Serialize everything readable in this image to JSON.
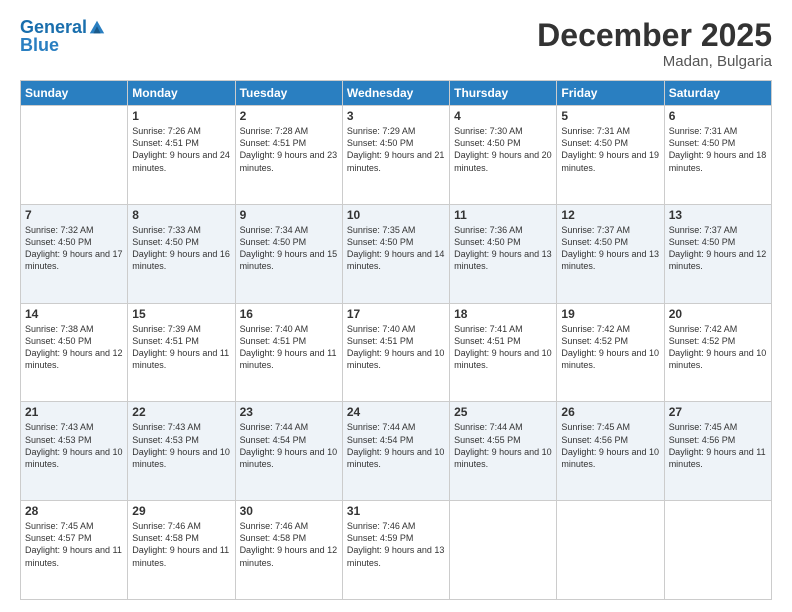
{
  "header": {
    "logo_line1": "General",
    "logo_line2": "Blue",
    "month": "December 2025",
    "location": "Madan, Bulgaria"
  },
  "days_of_week": [
    "Sunday",
    "Monday",
    "Tuesday",
    "Wednesday",
    "Thursday",
    "Friday",
    "Saturday"
  ],
  "weeks": [
    [
      {
        "day": "",
        "sunrise": "",
        "sunset": "",
        "daylight": ""
      },
      {
        "day": "1",
        "sunrise": "Sunrise: 7:26 AM",
        "sunset": "Sunset: 4:51 PM",
        "daylight": "Daylight: 9 hours and 24 minutes."
      },
      {
        "day": "2",
        "sunrise": "Sunrise: 7:28 AM",
        "sunset": "Sunset: 4:51 PM",
        "daylight": "Daylight: 9 hours and 23 minutes."
      },
      {
        "day": "3",
        "sunrise": "Sunrise: 7:29 AM",
        "sunset": "Sunset: 4:50 PM",
        "daylight": "Daylight: 9 hours and 21 minutes."
      },
      {
        "day": "4",
        "sunrise": "Sunrise: 7:30 AM",
        "sunset": "Sunset: 4:50 PM",
        "daylight": "Daylight: 9 hours and 20 minutes."
      },
      {
        "day": "5",
        "sunrise": "Sunrise: 7:31 AM",
        "sunset": "Sunset: 4:50 PM",
        "daylight": "Daylight: 9 hours and 19 minutes."
      },
      {
        "day": "6",
        "sunrise": "Sunrise: 7:31 AM",
        "sunset": "Sunset: 4:50 PM",
        "daylight": "Daylight: 9 hours and 18 minutes."
      }
    ],
    [
      {
        "day": "7",
        "sunrise": "Sunrise: 7:32 AM",
        "sunset": "Sunset: 4:50 PM",
        "daylight": "Daylight: 9 hours and 17 minutes."
      },
      {
        "day": "8",
        "sunrise": "Sunrise: 7:33 AM",
        "sunset": "Sunset: 4:50 PM",
        "daylight": "Daylight: 9 hours and 16 minutes."
      },
      {
        "day": "9",
        "sunrise": "Sunrise: 7:34 AM",
        "sunset": "Sunset: 4:50 PM",
        "daylight": "Daylight: 9 hours and 15 minutes."
      },
      {
        "day": "10",
        "sunrise": "Sunrise: 7:35 AM",
        "sunset": "Sunset: 4:50 PM",
        "daylight": "Daylight: 9 hours and 14 minutes."
      },
      {
        "day": "11",
        "sunrise": "Sunrise: 7:36 AM",
        "sunset": "Sunset: 4:50 PM",
        "daylight": "Daylight: 9 hours and 13 minutes."
      },
      {
        "day": "12",
        "sunrise": "Sunrise: 7:37 AM",
        "sunset": "Sunset: 4:50 PM",
        "daylight": "Daylight: 9 hours and 13 minutes."
      },
      {
        "day": "13",
        "sunrise": "Sunrise: 7:37 AM",
        "sunset": "Sunset: 4:50 PM",
        "daylight": "Daylight: 9 hours and 12 minutes."
      }
    ],
    [
      {
        "day": "14",
        "sunrise": "Sunrise: 7:38 AM",
        "sunset": "Sunset: 4:50 PM",
        "daylight": "Daylight: 9 hours and 12 minutes."
      },
      {
        "day": "15",
        "sunrise": "Sunrise: 7:39 AM",
        "sunset": "Sunset: 4:51 PM",
        "daylight": "Daylight: 9 hours and 11 minutes."
      },
      {
        "day": "16",
        "sunrise": "Sunrise: 7:40 AM",
        "sunset": "Sunset: 4:51 PM",
        "daylight": "Daylight: 9 hours and 11 minutes."
      },
      {
        "day": "17",
        "sunrise": "Sunrise: 7:40 AM",
        "sunset": "Sunset: 4:51 PM",
        "daylight": "Daylight: 9 hours and 10 minutes."
      },
      {
        "day": "18",
        "sunrise": "Sunrise: 7:41 AM",
        "sunset": "Sunset: 4:51 PM",
        "daylight": "Daylight: 9 hours and 10 minutes."
      },
      {
        "day": "19",
        "sunrise": "Sunrise: 7:42 AM",
        "sunset": "Sunset: 4:52 PM",
        "daylight": "Daylight: 9 hours and 10 minutes."
      },
      {
        "day": "20",
        "sunrise": "Sunrise: 7:42 AM",
        "sunset": "Sunset: 4:52 PM",
        "daylight": "Daylight: 9 hours and 10 minutes."
      }
    ],
    [
      {
        "day": "21",
        "sunrise": "Sunrise: 7:43 AM",
        "sunset": "Sunset: 4:53 PM",
        "daylight": "Daylight: 9 hours and 10 minutes."
      },
      {
        "day": "22",
        "sunrise": "Sunrise: 7:43 AM",
        "sunset": "Sunset: 4:53 PM",
        "daylight": "Daylight: 9 hours and 10 minutes."
      },
      {
        "day": "23",
        "sunrise": "Sunrise: 7:44 AM",
        "sunset": "Sunset: 4:54 PM",
        "daylight": "Daylight: 9 hours and 10 minutes."
      },
      {
        "day": "24",
        "sunrise": "Sunrise: 7:44 AM",
        "sunset": "Sunset: 4:54 PM",
        "daylight": "Daylight: 9 hours and 10 minutes."
      },
      {
        "day": "25",
        "sunrise": "Sunrise: 7:44 AM",
        "sunset": "Sunset: 4:55 PM",
        "daylight": "Daylight: 9 hours and 10 minutes."
      },
      {
        "day": "26",
        "sunrise": "Sunrise: 7:45 AM",
        "sunset": "Sunset: 4:56 PM",
        "daylight": "Daylight: 9 hours and 10 minutes."
      },
      {
        "day": "27",
        "sunrise": "Sunrise: 7:45 AM",
        "sunset": "Sunset: 4:56 PM",
        "daylight": "Daylight: 9 hours and 11 minutes."
      }
    ],
    [
      {
        "day": "28",
        "sunrise": "Sunrise: 7:45 AM",
        "sunset": "Sunset: 4:57 PM",
        "daylight": "Daylight: 9 hours and 11 minutes."
      },
      {
        "day": "29",
        "sunrise": "Sunrise: 7:46 AM",
        "sunset": "Sunset: 4:58 PM",
        "daylight": "Daylight: 9 hours and 11 minutes."
      },
      {
        "day": "30",
        "sunrise": "Sunrise: 7:46 AM",
        "sunset": "Sunset: 4:58 PM",
        "daylight": "Daylight: 9 hours and 12 minutes."
      },
      {
        "day": "31",
        "sunrise": "Sunrise: 7:46 AM",
        "sunset": "Sunset: 4:59 PM",
        "daylight": "Daylight: 9 hours and 13 minutes."
      },
      {
        "day": "",
        "sunrise": "",
        "sunset": "",
        "daylight": ""
      },
      {
        "day": "",
        "sunrise": "",
        "sunset": "",
        "daylight": ""
      },
      {
        "day": "",
        "sunrise": "",
        "sunset": "",
        "daylight": ""
      }
    ]
  ]
}
